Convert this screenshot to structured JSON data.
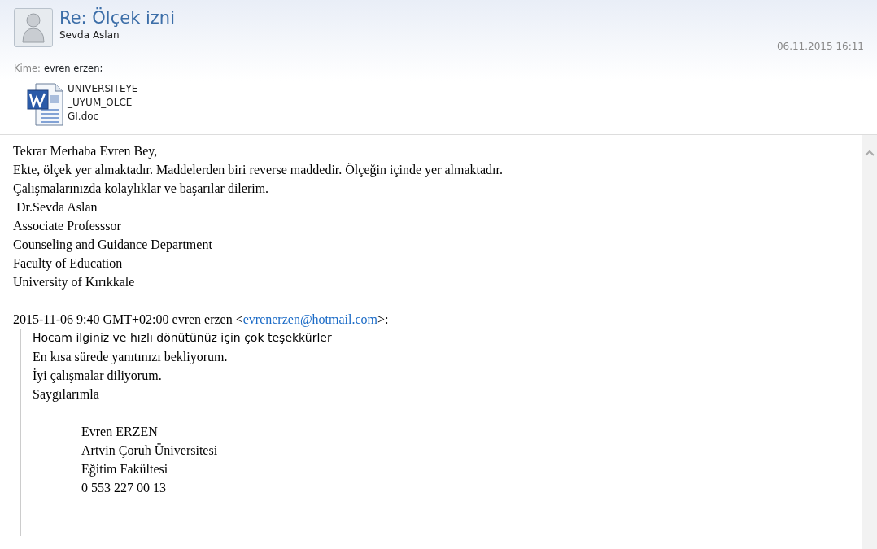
{
  "header": {
    "subject": "Re: Ölçek izni",
    "sender": "Sevda Aslan",
    "date": "06.11.2015 16:11",
    "to_label": "Kime:",
    "to_value": "evren erzen;",
    "attachment": {
      "name_lines": [
        "UNIVERSITEYE",
        "_UYUM_OLCE",
        "GI.doc"
      ]
    }
  },
  "body": {
    "lines": [
      "Tekrar Merhaba Evren Bey,",
      "Ekte, ölçek yer almaktadır. Maddelerden biri reverse maddedir. Ölçeğin içinde yer almaktadır.",
      "Çalışmalarınızda kolaylıklar ve başarılar dilerim.",
      " Dr.Sevda Aslan",
      "Associate Professsor",
      "Counseling and Guidance Department",
      "Faculty of Education",
      "University of Kırıkkale"
    ]
  },
  "quote": {
    "attribution": {
      "prefix": "2015-11-06 9:40 GMT+02:00 evren erzen <",
      "email": "evrenerzen@hotmail.com",
      "suffix": ">:"
    },
    "lines": [
      {
        "kind": "sans",
        "text": "Hocam ilginiz ve hızlı dönütünüz için çok teşekkürler"
      },
      {
        "kind": "serif",
        "text": "En kısa sürede yanıtınızı bekliyorum."
      },
      {
        "kind": "serif",
        "text": "İyi çalışmalar diliyorum."
      },
      {
        "kind": "serif",
        "text": "Saygılarımla"
      }
    ],
    "signature": [
      "Evren ERZEN",
      "Artvin Çoruh Üniversitesi",
      "Eğitim Fakültesi",
      "0 553 227 00 13"
    ]
  }
}
